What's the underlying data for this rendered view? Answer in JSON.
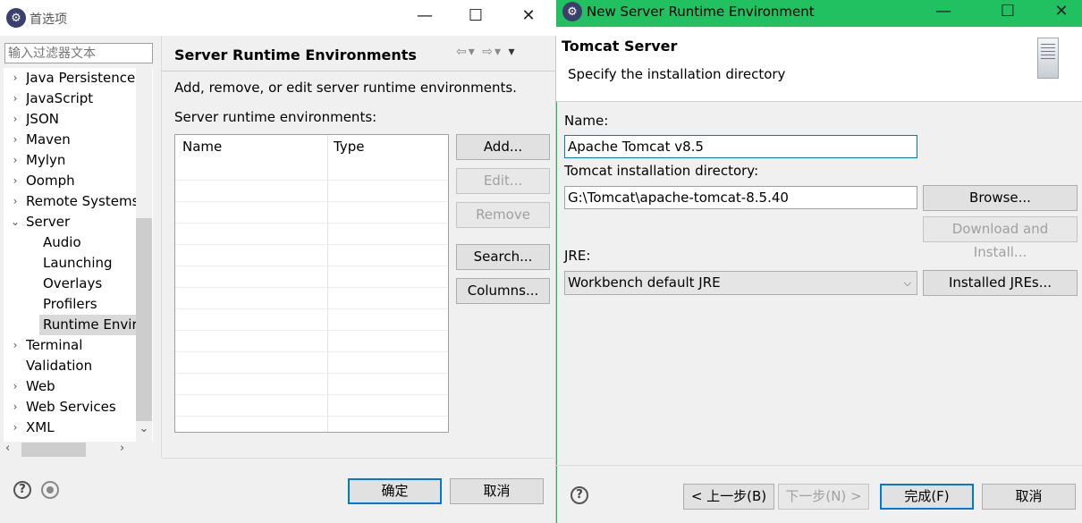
{
  "preferences": {
    "title": "首选项",
    "filter_placeholder": "输入过滤器文本",
    "tree": [
      {
        "label": "Java Persistence",
        "arrow": "›"
      },
      {
        "label": "JavaScript",
        "arrow": "›"
      },
      {
        "label": "JSON",
        "arrow": "›"
      },
      {
        "label": "Maven",
        "arrow": "›"
      },
      {
        "label": "Mylyn",
        "arrow": "›"
      },
      {
        "label": "Oomph",
        "arrow": "›"
      },
      {
        "label": "Remote Systems",
        "arrow": "›"
      },
      {
        "label": "Server",
        "arrow": "⌄"
      },
      {
        "label": "Audio",
        "arrow": ""
      },
      {
        "label": "Launching",
        "arrow": ""
      },
      {
        "label": "Overlays",
        "arrow": ""
      },
      {
        "label": "Profilers",
        "arrow": ""
      },
      {
        "label": "Runtime Enviro",
        "arrow": ""
      },
      {
        "label": "Terminal",
        "arrow": "›"
      },
      {
        "label": "Validation",
        "arrow": ""
      },
      {
        "label": "Web",
        "arrow": "›"
      },
      {
        "label": "Web Services",
        "arrow": "›"
      },
      {
        "label": "XML",
        "arrow": "›"
      }
    ],
    "page_title": "Server Runtime Environments",
    "description": "Add, remove, or edit server runtime environments.",
    "list_label": "Server runtime environments:",
    "columns": [
      "Name",
      "Type"
    ],
    "buttons": {
      "add": "Add...",
      "edit": "Edit...",
      "remove": "Remove",
      "search": "Search...",
      "columns": "Columns..."
    },
    "ok": "确定",
    "cancel": "取消"
  },
  "dialog": {
    "title": "New Server Runtime Environment",
    "header_title": "Tomcat Server",
    "header_message": "Specify the installation directory",
    "name_label": "Name:",
    "name_value": "Apache Tomcat v8.5",
    "dir_label": "Tomcat installation directory:",
    "dir_value": "G:\\Tomcat\\apache-tomcat-8.5.40",
    "browse": "Browse...",
    "download": "Download and Install...",
    "jre_label": "JRE:",
    "jre_value": "Workbench default JRE",
    "installed_jres": "Installed JREs...",
    "back": "< 上一步(B)",
    "next": "下一步(N) >",
    "finish": "完成(F)",
    "cancel": "取消"
  },
  "colors": {
    "dialog_titlebar": "#21c060",
    "focus_border": "#0078d7"
  }
}
